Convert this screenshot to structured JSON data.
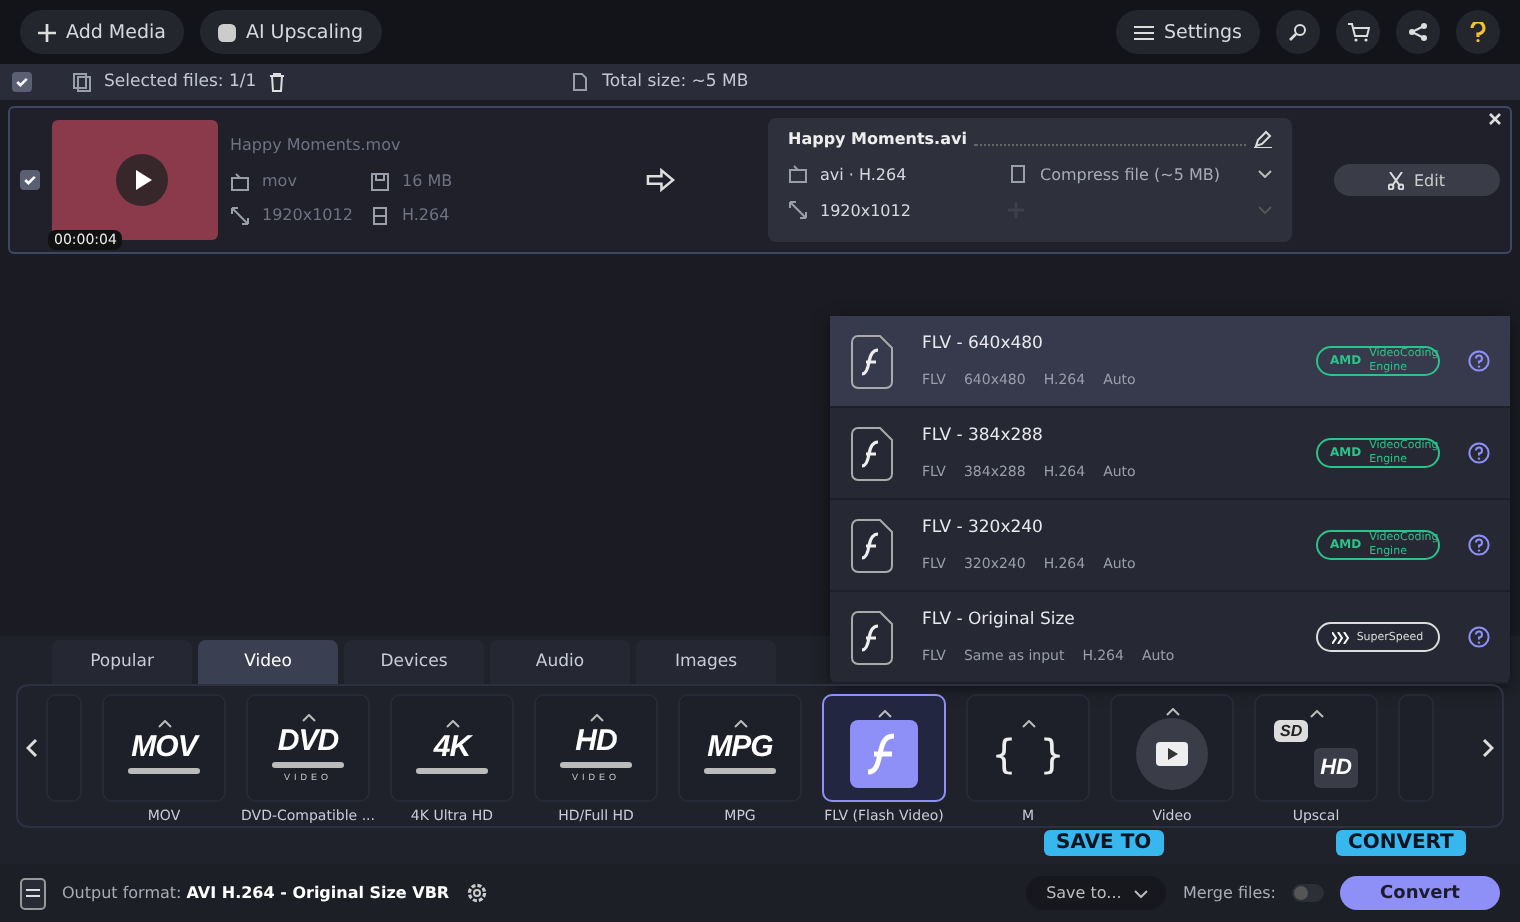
{
  "top_bar": {
    "add_media": "Add Media",
    "ai_upscaling": "AI Upscaling",
    "settings": "Settings"
  },
  "toolbar": {
    "select_all_checked": true,
    "selected_files": "Selected files: 1/1",
    "total_size": "Total size: ~5 MB"
  },
  "file": {
    "checked": true,
    "duration": "00:00:04",
    "name": "Happy Moments.mov",
    "format": "mov",
    "size": "16 MB",
    "resolution": "1920x1012",
    "codec": "H.264",
    "output": {
      "name": "Happy Moments.avi",
      "format": "avi · H.264",
      "compress": "Compress file (~5 MB)",
      "resolution": "1920x1012"
    },
    "edit": "Edit"
  },
  "preset_dropdown": [
    {
      "title": "FLV - 640x480",
      "specs": [
        "FLV",
        "640x480",
        "H.264",
        "Auto"
      ],
      "badge": {
        "kind": "amd",
        "label": "AMD",
        "text": "VideoCoding Engine"
      },
      "selected": true
    },
    {
      "title": "FLV - 384x288",
      "specs": [
        "FLV",
        "384x288",
        "H.264",
        "Auto"
      ],
      "badge": {
        "kind": "amd",
        "label": "AMD",
        "text": "VideoCoding Engine"
      },
      "selected": false
    },
    {
      "title": "FLV - 320x240",
      "specs": [
        "FLV",
        "320x240",
        "H.264",
        "Auto"
      ],
      "badge": {
        "kind": "amd",
        "label": "AMD",
        "text": "VideoCoding Engine"
      },
      "selected": false
    },
    {
      "title": "FLV - Original Size",
      "specs": [
        "FLV",
        "Same as input",
        "H.264",
        "Auto"
      ],
      "badge": {
        "kind": "superspeed",
        "text": "SuperSpeed"
      },
      "selected": false
    }
  ],
  "tabs": [
    {
      "label": "Popular",
      "selected": false
    },
    {
      "label": "Video",
      "selected": true
    },
    {
      "label": "Devices",
      "selected": false
    },
    {
      "label": "Audio",
      "selected": false
    },
    {
      "label": "Images",
      "selected": false
    }
  ],
  "formats": [
    {
      "kind": "logo",
      "logo": "MOV",
      "label": "MOV",
      "selected": false
    },
    {
      "kind": "logo",
      "logo": "DVD",
      "sub": "VIDEO",
      "label": "DVD-Compatible ...",
      "selected": false
    },
    {
      "kind": "logo",
      "logo": "4K",
      "label": "4K Ultra HD",
      "selected": false
    },
    {
      "kind": "logo",
      "logo": "HD",
      "sub": "VIDEO",
      "label": "HD/Full HD",
      "selected": false
    },
    {
      "kind": "logo",
      "logo": "MPG",
      "label": "MPG",
      "selected": false
    },
    {
      "kind": "flash",
      "label": "FLV (Flash Video)",
      "selected": true
    },
    {
      "kind": "braces",
      "logo": "{ }",
      "label": "M",
      "selected": false
    },
    {
      "kind": "play",
      "label": "Video",
      "selected": false
    },
    {
      "kind": "sdhd",
      "logo": "SD",
      "logo2": "HD",
      "label": "Upscal",
      "selected": false
    }
  ],
  "bottom_bar": {
    "output_format": "Output format: **AVI H.264 - Original Size VBR**",
    "save_to": "Save to...",
    "merge_files": "Merge files:",
    "merge_on": false,
    "convert": "Convert"
  },
  "callouts": [
    "SAVE TO",
    "CONVERT"
  ]
}
